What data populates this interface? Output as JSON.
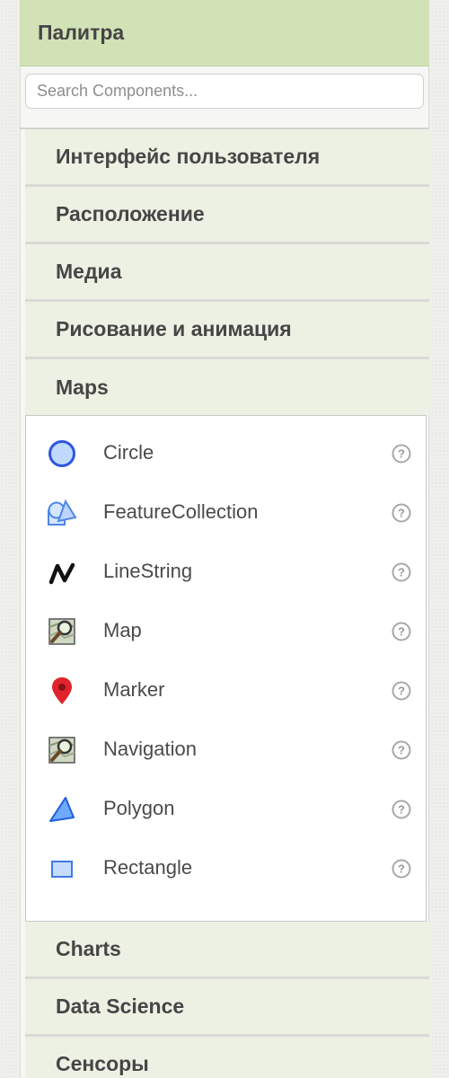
{
  "palette": {
    "title": "Палитра",
    "search_placeholder": "Search Components..."
  },
  "categories_top": [
    {
      "label": "Интерфейс пользователя"
    },
    {
      "label": "Расположение"
    },
    {
      "label": "Медиа"
    },
    {
      "label": "Рисование и анимация"
    },
    {
      "label": "Maps"
    }
  ],
  "maps_components": [
    {
      "label": "Circle",
      "icon": "circle-icon"
    },
    {
      "label": "FeatureCollection",
      "icon": "feature-collection-icon"
    },
    {
      "label": "LineString",
      "icon": "linestring-icon"
    },
    {
      "label": "Map",
      "icon": "map-icon"
    },
    {
      "label": "Marker",
      "icon": "marker-icon"
    },
    {
      "label": "Navigation",
      "icon": "navigation-icon"
    },
    {
      "label": "Polygon",
      "icon": "polygon-icon"
    },
    {
      "label": "Rectangle",
      "icon": "rectangle-icon"
    }
  ],
  "categories_bottom": [
    {
      "label": "Charts"
    },
    {
      "label": "Data Science"
    },
    {
      "label": "Сенсоры"
    }
  ],
  "colors": {
    "header_bg": "#d1e2b7",
    "category_bg": "#edf1e3",
    "circle_blue": "#2f55e0",
    "marker_red": "#e0242c"
  }
}
